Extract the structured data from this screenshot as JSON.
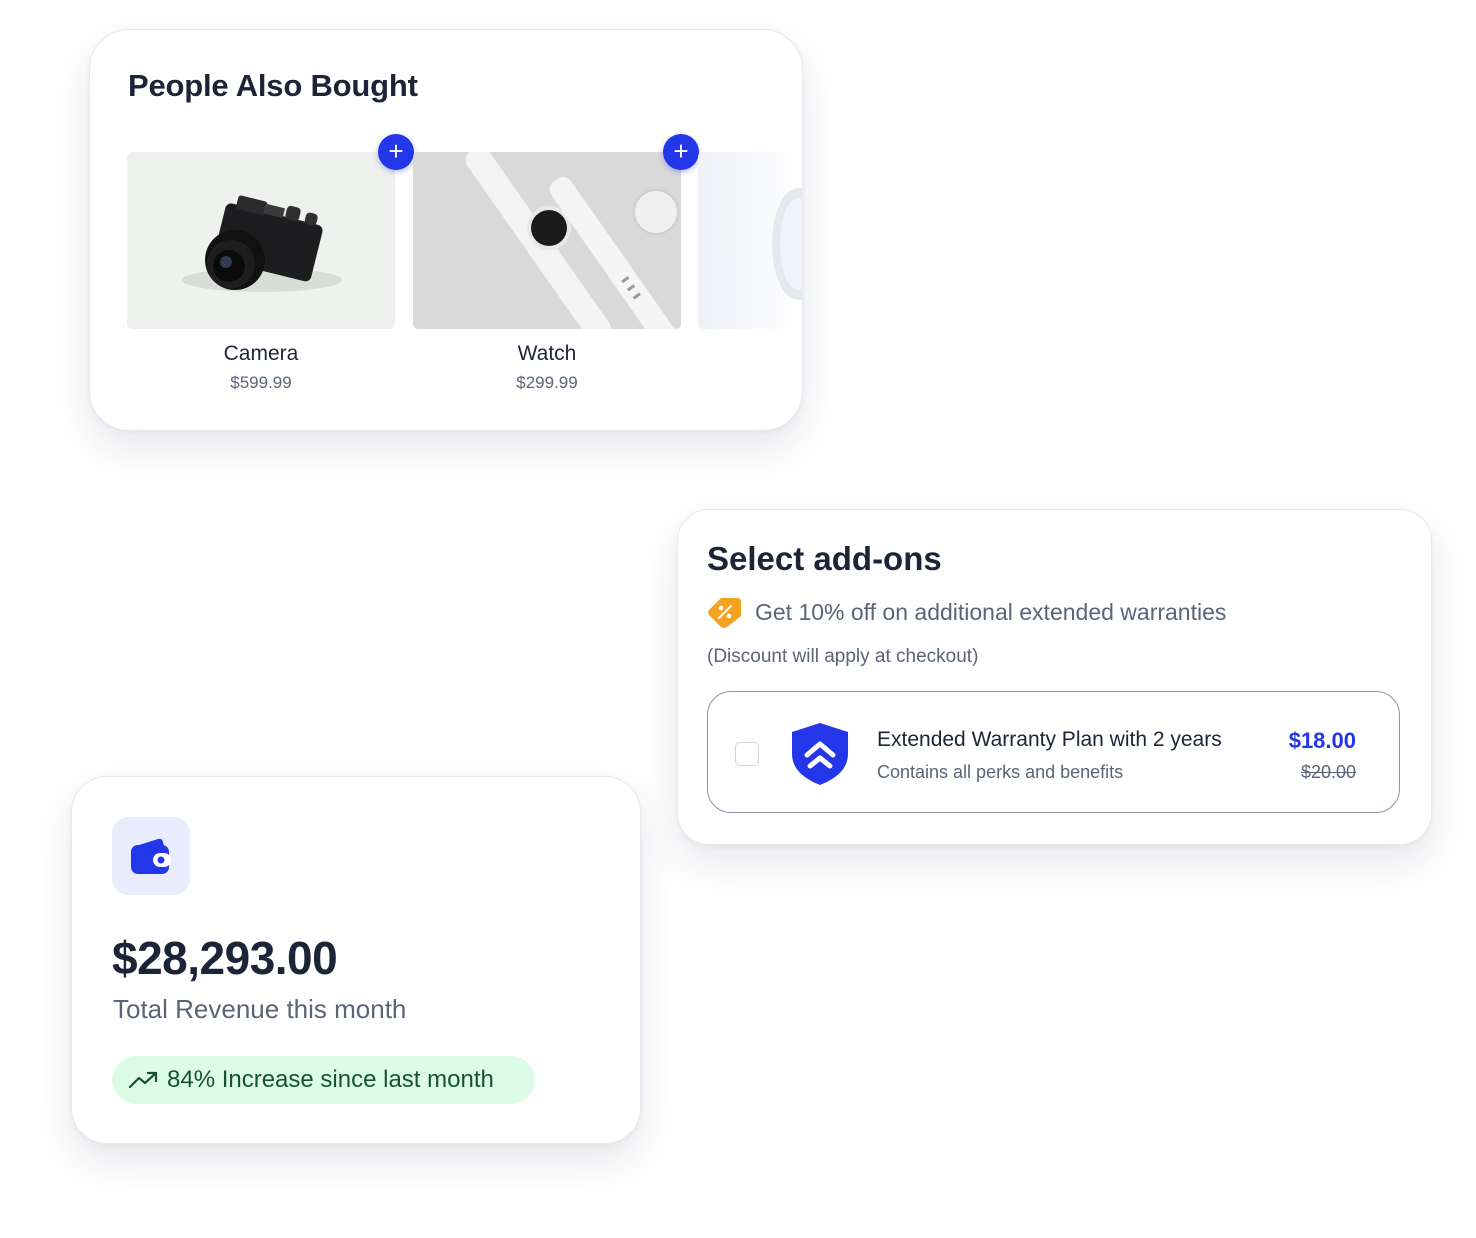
{
  "people_also_bought": {
    "title": "People Also Bought",
    "products": [
      {
        "name": "Camera",
        "price": "$599.99",
        "add_label": "+"
      },
      {
        "name": "Watch",
        "price": "$299.99",
        "add_label": "+"
      }
    ]
  },
  "addons": {
    "title": "Select add-ons",
    "promo_text": "Get 10% off on additional extended warranties",
    "note": "(Discount will apply at checkout)",
    "warranty": {
      "name": "Extended Warranty Plan with 2 years",
      "description": "Contains all perks and benefits",
      "price": "$18.00",
      "original_price": "$20.00",
      "checked": false
    },
    "icons": {
      "tag": "discount-tag-icon",
      "shield": "shield-chevrons-up-icon"
    }
  },
  "revenue": {
    "amount": "$28,293.00",
    "label": "Total Revenue this month",
    "badge_text": "84% Increase since last month",
    "icons": {
      "wallet": "wallet-icon",
      "trend": "trending-up-icon"
    }
  },
  "colors": {
    "accent": "#2336e8",
    "tag": "#f3a321",
    "badge_bg": "#dcfce7",
    "badge_text": "#14532d",
    "heading": "#1c2437",
    "muted": "#5b6478"
  }
}
